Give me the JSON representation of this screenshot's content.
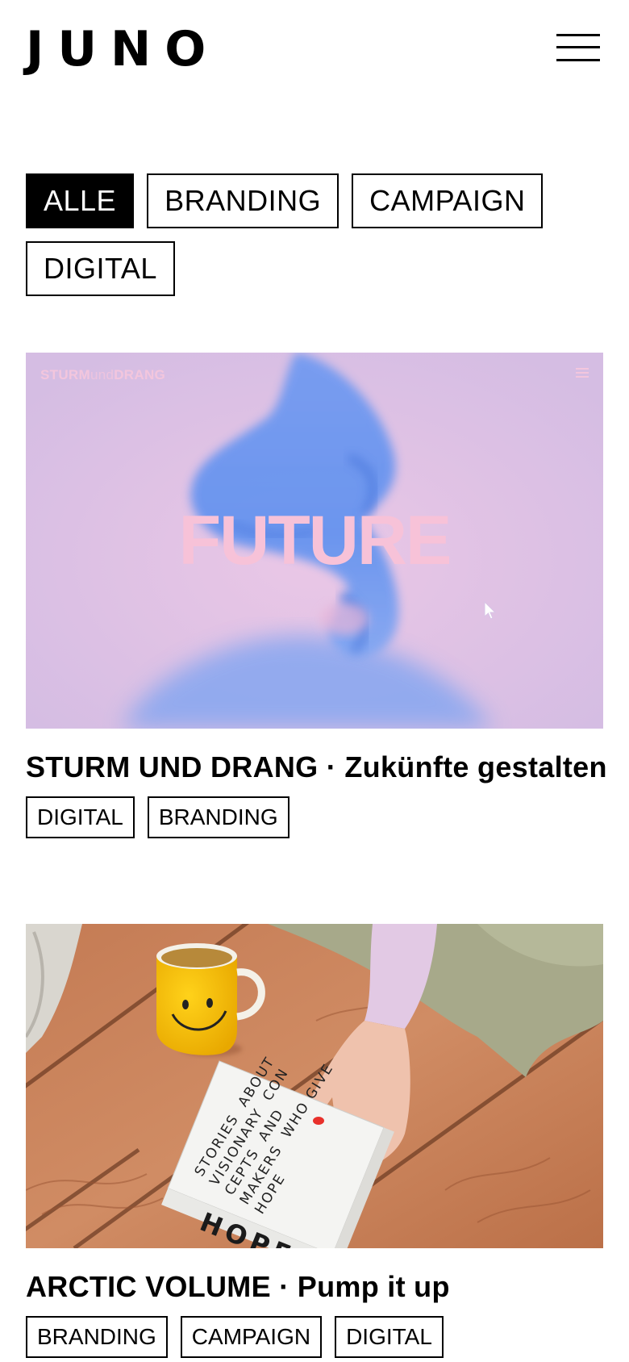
{
  "header": {
    "logo": "JUNO",
    "menu_icon": "hamburger-menu-icon"
  },
  "filters": [
    {
      "label": "ALLE",
      "active": true
    },
    {
      "label": "BRANDING",
      "active": false
    },
    {
      "label": "CAMPAIGN",
      "active": false
    },
    {
      "label": "DIGITAL",
      "active": false
    }
  ],
  "projects": [
    {
      "title": "STURM UND DRANG · Zukünfte gestalten",
      "tags": [
        "DIGITAL",
        "BRANDING"
      ],
      "thumbnail": {
        "logo_left": "STURM",
        "logo_mid": "und",
        "logo_right": "DRANG",
        "headline": "FUTURE"
      }
    },
    {
      "title": "ARCTIC VOLUME · Pump it up",
      "tags": [
        "BRANDING",
        "CAMPAIGN",
        "DIGITAL"
      ],
      "thumbnail": {
        "book_words": [
          "STORIES",
          "ABOUT",
          "VISIONARY",
          "CON",
          "CEPTS",
          "AND",
          "MAKERS",
          "WHO GIVE",
          "HOPE"
        ],
        "book_spine": "HOPE"
      }
    }
  ],
  "colors": {
    "accent": "#000000",
    "future_text": "#f7c2d8",
    "future_bg": "#d8c3e6",
    "figure_blue": "#5b8ff0"
  }
}
